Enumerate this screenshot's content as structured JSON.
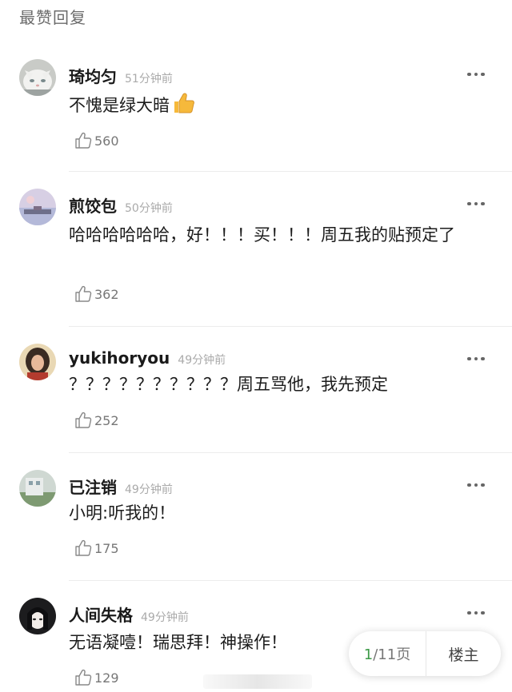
{
  "section_title": "最赞回复",
  "colors": {
    "page_number_current": "#3c9a47",
    "thumb_emoji": "#f6b93b"
  },
  "comments": [
    {
      "username": "琦均匀",
      "time": "51分钟前",
      "text": "不愧是绿大暗",
      "emoji": "thumbs-up-emoji",
      "likes": "560",
      "avatar": "cat-avatar"
    },
    {
      "username": "煎饺包",
      "time": "50分钟前",
      "text": "哈哈哈哈哈哈，好！！！买！！！周五我的贴预定了",
      "likes": "362",
      "avatar": "landscape-avatar"
    },
    {
      "username": "yukihoryou",
      "time": "49分钟前",
      "text": "？？？？？？？？？？周五骂他，我先预定",
      "likes": "252",
      "avatar": "portrait-avatar"
    },
    {
      "username": "已注销",
      "time": "49分钟前",
      "text": "小明:听我的！",
      "likes": "175",
      "avatar": "building-avatar"
    },
    {
      "username": "人间失格",
      "time": "49分钟前",
      "text": "无语凝噎！瑞思拜！神操作！",
      "likes": "129",
      "avatar": "anime-avatar"
    }
  ],
  "pager": {
    "current": "1",
    "total": "/11页",
    "owner_label": "楼主"
  }
}
